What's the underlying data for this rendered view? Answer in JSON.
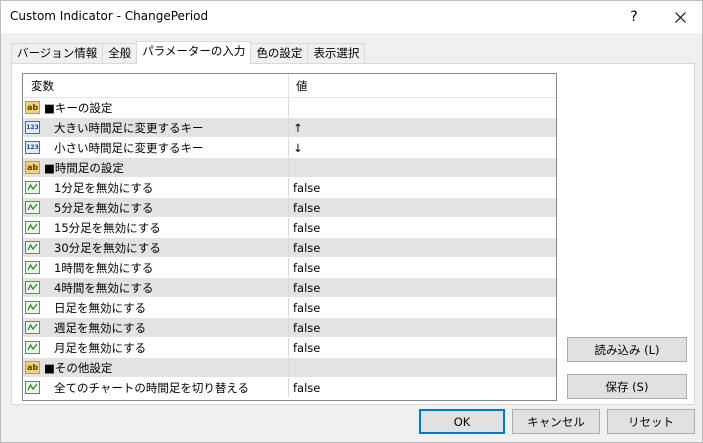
{
  "window": {
    "title": "Custom Indicator - ChangePeriod",
    "help_label": "?"
  },
  "tabs": [
    {
      "label": "バージョン情報"
    },
    {
      "label": "全般"
    },
    {
      "label": "パラメーターの入力"
    },
    {
      "label": "色の設定"
    },
    {
      "label": "表示選択"
    }
  ],
  "grid": {
    "col_variable": "変数",
    "col_value": "値",
    "rows": [
      {
        "icon": "ab-icon",
        "label": "■キーの設定",
        "value": ""
      },
      {
        "icon": "number-icon",
        "label": "大きい時間足に変更するキー",
        "value": "↑"
      },
      {
        "icon": "number-icon",
        "label": "小さい時間足に変更するキー",
        "value": "↓"
      },
      {
        "icon": "ab-icon",
        "label": "■時間足の設定",
        "value": ""
      },
      {
        "icon": "boolean-icon",
        "label": "1分足を無効にする",
        "value": "false"
      },
      {
        "icon": "boolean-icon",
        "label": "5分足を無効にする",
        "value": "false"
      },
      {
        "icon": "boolean-icon",
        "label": "15分足を無効にする",
        "value": "false"
      },
      {
        "icon": "boolean-icon",
        "label": "30分足を無効にする",
        "value": "false"
      },
      {
        "icon": "boolean-icon",
        "label": "1時間を無効にする",
        "value": "false"
      },
      {
        "icon": "boolean-icon",
        "label": "4時間を無効にする",
        "value": "false"
      },
      {
        "icon": "boolean-icon",
        "label": "日足を無効にする",
        "value": "false"
      },
      {
        "icon": "boolean-icon",
        "label": "週足を無効にする",
        "value": "false"
      },
      {
        "icon": "boolean-icon",
        "label": "月足を無効にする",
        "value": "false"
      },
      {
        "icon": "ab-icon",
        "label": "■その他設定",
        "value": ""
      },
      {
        "icon": "boolean-icon",
        "label": "全てのチャートの時間足を切り替える",
        "value": "false"
      }
    ]
  },
  "side_buttons": {
    "load_label": "読み込み (L)",
    "save_label": "保存 (S)"
  },
  "bottom_buttons": {
    "ok_label": "OK",
    "cancel_label": "キャンセル",
    "reset_label": "リセット"
  }
}
